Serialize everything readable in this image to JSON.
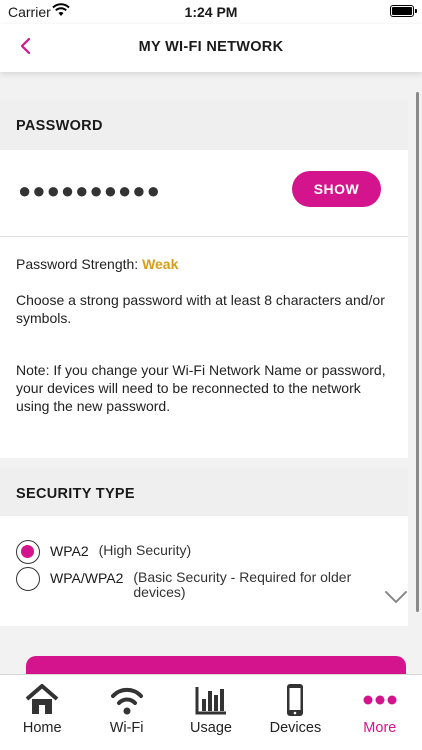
{
  "status_bar": {
    "carrier": "Carrier",
    "time": "1:24 PM"
  },
  "header": {
    "title": "MY WI-FI NETWORK",
    "back_icon": "chevron-left-icon"
  },
  "password": {
    "section_title": "PASSWORD",
    "masked_value": "●●●●●●●●●●",
    "show_label": "SHOW",
    "strength_label": "Password Strength:",
    "strength_value": "Weak",
    "hint": "Choose a strong password with at least 8 characters and/or symbols.",
    "note": "Note: If you change your Wi-Fi Network Name or password, your devices will need to be reconnected to the network using the new password."
  },
  "security": {
    "section_title": "SECURITY TYPE",
    "options": [
      {
        "label": "WPA2",
        "description": "(High Security)",
        "selected": true
      },
      {
        "label": "WPA/WPA2",
        "description": "(Basic Security - Required for older devices)",
        "selected": false
      }
    ]
  },
  "tabs": [
    {
      "label": "Home",
      "icon": "home-icon"
    },
    {
      "label": "Wi-Fi",
      "icon": "wifi-icon"
    },
    {
      "label": "Usage",
      "icon": "bar-chart-icon"
    },
    {
      "label": "Devices",
      "icon": "phone-icon"
    },
    {
      "label": "More",
      "icon": "more-dots-icon",
      "active": true
    }
  ],
  "colors": {
    "accent": "#d4148c",
    "weak": "#d69e18"
  }
}
